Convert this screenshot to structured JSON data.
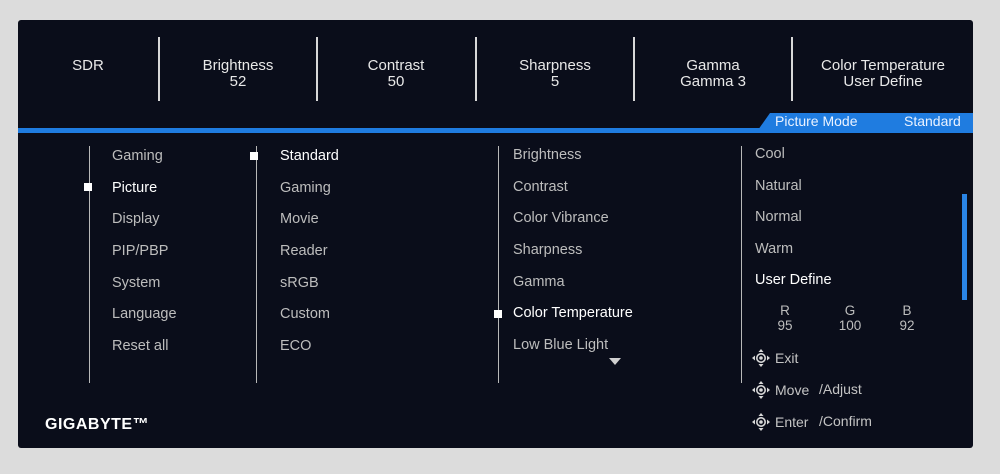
{
  "status": {
    "mode": "SDR",
    "brightness": {
      "label": "Brightness",
      "value": "52"
    },
    "contrast": {
      "label": "Contrast",
      "value": "50"
    },
    "sharpness": {
      "label": "Sharpness",
      "value": "5"
    },
    "gamma": {
      "label": "Gamma",
      "value": "Gamma 3"
    },
    "color_temp": {
      "label": "Color Temperature",
      "value": "User Define"
    }
  },
  "picture_mode": {
    "label": "Picture Mode",
    "value": "Standard"
  },
  "main_menu": [
    "Gaming",
    "Picture",
    "Display",
    "PIP/PBP",
    "System",
    "Language",
    "Reset all"
  ],
  "main_selected": "Picture",
  "modes": [
    "Standard",
    "Gaming",
    "Movie",
    "Reader",
    "sRGB",
    "Custom",
    "ECO"
  ],
  "mode_selected": "Standard",
  "settings": [
    "Brightness",
    "Contrast",
    "Color Vibrance",
    "Sharpness",
    "Gamma",
    "Color Temperature",
    "Low Blue Light"
  ],
  "setting_selected": "Color Temperature",
  "temperatures": [
    "Cool",
    "Natural",
    "Normal",
    "Warm",
    "User Define"
  ],
  "temperature_selected": "User Define",
  "rgb": {
    "r_label": "R",
    "r_value": "95",
    "g_label": "G",
    "g_value": "100",
    "b_label": "B",
    "b_value": "92"
  },
  "hints": {
    "exit": "Exit",
    "move": "Move",
    "adjust": "/Adjust",
    "enter": "Enter",
    "confirm": "/Confirm"
  },
  "brand": "GIGABYTE™",
  "colors": {
    "accent": "#1f7ce0",
    "background": "#0a0d1a",
    "text": "#bdbdbd",
    "selected": "#ffffff"
  },
  "icons": {
    "joystick": "joystick-icon",
    "scroll_down": "chevron-down-icon"
  }
}
